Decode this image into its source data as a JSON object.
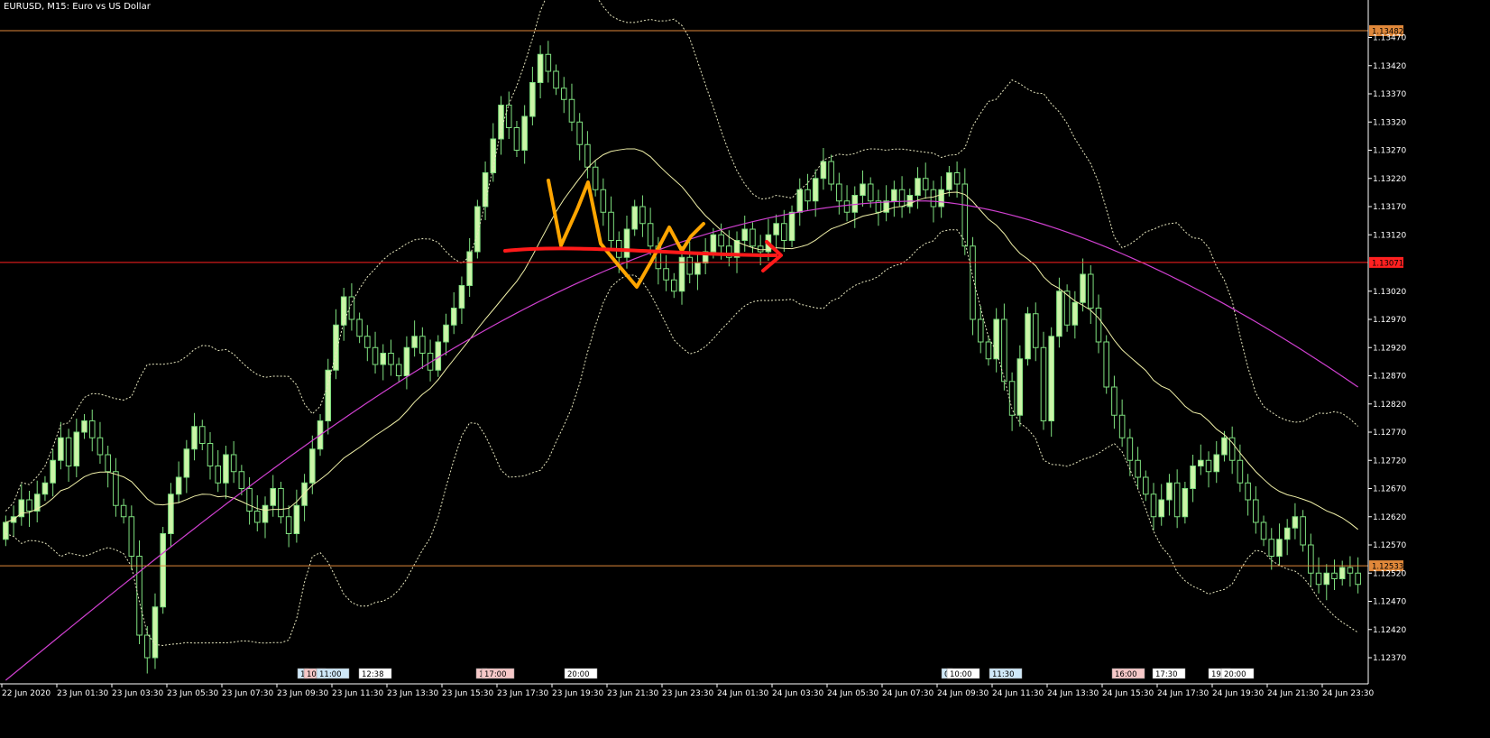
{
  "header": {
    "title": "EURUSD, M15:  Euro vs US Dollar"
  },
  "colors": {
    "background": "#000000",
    "grid": "#000000",
    "axis": "#ffffff",
    "candle_bull": "#ccf5a8",
    "candle_bear": "#7fe07f",
    "ma_fast": "#f0f0a8",
    "ma_slow": "#d040d0",
    "bands": "#e8e8c0",
    "level_high": "#e0883a",
    "level_mid": "#ff2020",
    "level_low": "#e0883a",
    "annotation_orange": "#ffa500",
    "annotation_red": "#ff1a1a"
  },
  "chart_data": {
    "type": "candlestick",
    "symbol": "EURUSD",
    "timeframe": "M15",
    "ylim": [
      1.1233,
      1.1353
    ],
    "y_ticks": [
      "1.13470",
      "1.13420",
      "1.13370",
      "1.13320",
      "1.13270",
      "1.13220",
      "1.13170",
      "1.13120",
      "1.13020",
      "1.12970",
      "1.12920",
      "1.12870",
      "1.12820",
      "1.12770",
      "1.12720",
      "1.12670",
      "1.12620",
      "1.12570",
      "1.12520",
      "1.12470",
      "1.12420",
      "1.12370"
    ],
    "x_ticks": [
      "22 Jun 2020",
      "23 Jun 01:30",
      "23 Jun 03:30",
      "23 Jun 05:30",
      "23 Jun 07:30",
      "23 Jun 09:30",
      "23 Jun 11:30",
      "23 Jun 13:30",
      "23 Jun 15:30",
      "23 Jun 17:30",
      "23 Jun 19:30",
      "23 Jun 21:30",
      "23 Jun 23:30",
      "24 Jun 01:30",
      "24 Jun 03:30",
      "24 Jun 05:30",
      "24 Jun 07:30",
      "24 Jun 09:30",
      "24 Jun 11:30",
      "24 Jun 13:30",
      "24 Jun 15:30",
      "24 Jun 17:30",
      "24 Jun 19:30",
      "24 Jun 21:30",
      "24 Jun 23:30"
    ],
    "price_levels": [
      {
        "value": 1.13482,
        "label": "1.13482",
        "color": "#e0883a"
      },
      {
        "value": 1.13071,
        "label": "1.13071",
        "color": "#ff2020"
      },
      {
        "value": 1.12533,
        "label": "1.12533",
        "color": "#e0883a"
      }
    ],
    "close": [
      1.1261,
      1.1262,
      1.1265,
      1.1263,
      1.1266,
      1.1268,
      1.1272,
      1.1276,
      1.1271,
      1.1277,
      1.1279,
      1.1276,
      1.1273,
      1.127,
      1.1264,
      1.1262,
      1.1255,
      1.1241,
      1.1237,
      1.1246,
      1.1259,
      1.1266,
      1.1269,
      1.1274,
      1.1278,
      1.1275,
      1.1271,
      1.1268,
      1.1273,
      1.127,
      1.1267,
      1.1263,
      1.1261,
      1.1264,
      1.1267,
      1.1262,
      1.1259,
      1.1264,
      1.1268,
      1.1274,
      1.1279,
      1.1288,
      1.1296,
      1.1301,
      1.1297,
      1.1294,
      1.1292,
      1.1289,
      1.1291,
      1.1289,
      1.1287,
      1.1292,
      1.1294,
      1.1291,
      1.1288,
      1.1293,
      1.1296,
      1.1299,
      1.1303,
      1.1309,
      1.1317,
      1.1323,
      1.1329,
      1.1335,
      1.1331,
      1.1327,
      1.1333,
      1.1339,
      1.1344,
      1.1341,
      1.1338,
      1.1336,
      1.1332,
      1.1328,
      1.1324,
      1.132,
      1.1316,
      1.1311,
      1.1308,
      1.1313,
      1.1317,
      1.1314,
      1.131,
      1.1306,
      1.1304,
      1.1302,
      1.1308,
      1.1305,
      1.1307,
      1.1309,
      1.1312,
      1.131,
      1.1308,
      1.1311,
      1.1313,
      1.131,
      1.1309,
      1.1312,
      1.1314,
      1.1311,
      1.1316,
      1.132,
      1.1318,
      1.1322,
      1.1325,
      1.1321,
      1.1318,
      1.1316,
      1.1319,
      1.1321,
      1.1318,
      1.1316,
      1.1318,
      1.132,
      1.1317,
      1.1319,
      1.1322,
      1.132,
      1.1317,
      1.132,
      1.1323,
      1.1321,
      1.131,
      1.1297,
      1.1293,
      1.129,
      1.1297,
      1.1286,
      1.128,
      1.129,
      1.1298,
      1.1292,
      1.1279,
      1.1294,
      1.1302,
      1.1296,
      1.13,
      1.1305,
      1.1299,
      1.1293,
      1.1285,
      1.128,
      1.1276,
      1.1272,
      1.1269,
      1.1266,
      1.1262,
      1.1265,
      1.1268,
      1.1262,
      1.1267,
      1.1271,
      1.1272,
      1.127,
      1.1273,
      1.1276,
      1.1272,
      1.1268,
      1.1265,
      1.1261,
      1.1258,
      1.1255,
      1.1258,
      1.126,
      1.1262,
      1.1257,
      1.1252,
      1.125,
      1.1252,
      1.1251,
      1.1253,
      1.1252,
      1.125
    ],
    "ma_slow_endpoints": {
      "start": 1.1233,
      "peak": 1.1318,
      "end": 1.1285
    },
    "time_tags": [
      {
        "label": "1",
        "color": "#cfe8f8"
      },
      {
        "label": "10:",
        "color": "#f6c8c8"
      },
      {
        "label": "11:00",
        "color": "#cfe8f8"
      },
      {
        "label": "12:38",
        "color": "#ffffff"
      },
      {
        "label": "1",
        "color": "#f6c8c8"
      },
      {
        "label": "17:00",
        "color": "#f6c8c8"
      },
      {
        "label": "20:00",
        "color": "#ffffff"
      },
      {
        "label": "0",
        "color": "#cfe8f8"
      },
      {
        "label": "10:00",
        "color": "#ffffff"
      },
      {
        "label": "11:30",
        "color": "#cfe8f8"
      },
      {
        "label": "16:00",
        "color": "#f6c8c8"
      },
      {
        "label": "17:30",
        "color": "#ffffff"
      },
      {
        "label": "19:",
        "color": "#ffffff"
      },
      {
        "label": "20:00",
        "color": "#ffffff"
      }
    ]
  }
}
